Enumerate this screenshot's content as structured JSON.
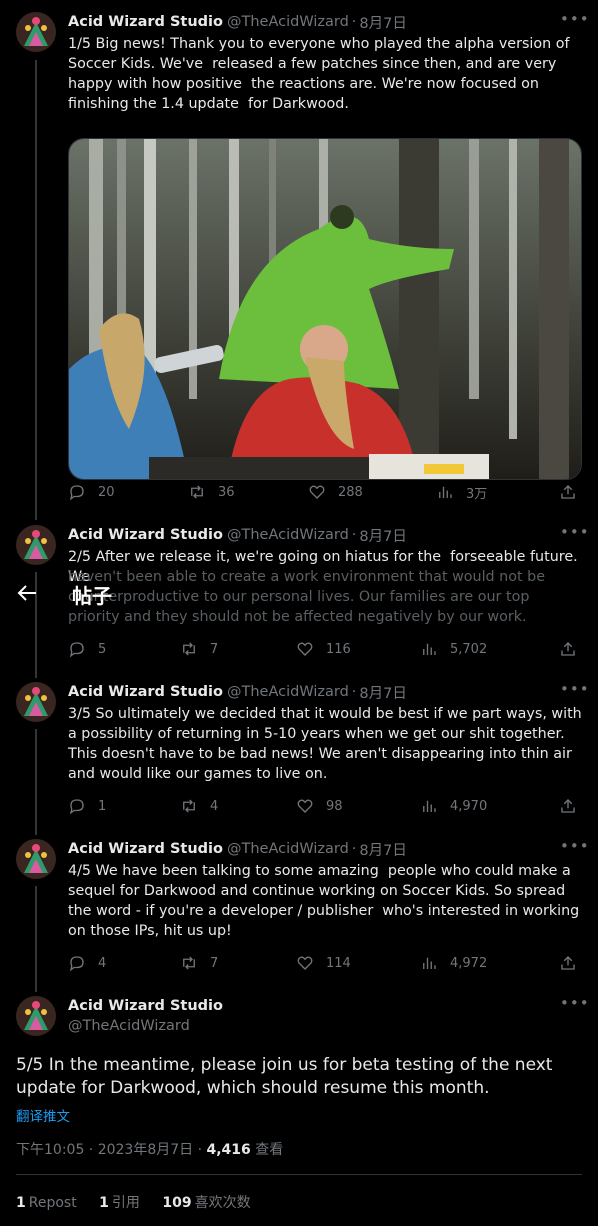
{
  "page": {
    "title": "帖子"
  },
  "account": {
    "name": "Acid Wizard Studio",
    "handle": "@TheAcidWizard",
    "separator": "·"
  },
  "tweets": [
    {
      "date": "8月7日",
      "text": "1/5 Big news! Thank you to everyone who played the alpha version of Soccer Kids. We've  released a few patches since then, and are very happy with how positive  the reactions are. We're now focused on finishing the 1.4 update  for Darkwood.",
      "replies": "20",
      "retweets": "36",
      "likes": "288",
      "views": "3万"
    },
    {
      "date": "8月7日",
      "text_line1": "2/5 After we release it, we're going on hiatus for the  forseeable future. We",
      "text_faded": "haven't been able to create a work environment that would not be counterproductive to our personal lives. Our families are our top priority and they should not be affected negatively by our work.",
      "replies": "5",
      "retweets": "7",
      "likes": "116",
      "views": "5,702"
    },
    {
      "date": "8月7日",
      "text": "3/5 So ultimately we decided that it would be best if we part ways, with a possibility of returning in 5-10 years when we get our shit together. This doesn't have to be bad news! We aren't disappearing into thin air and would like our games to live on.",
      "replies": "1",
      "retweets": "4",
      "likes": "98",
      "views": "4,970"
    },
    {
      "date": "8月7日",
      "text": "4/5 We have been talking to some amazing  people who could make a sequel for Darkwood and continue working on Soccer Kids. So spread the word - if you're a developer / publisher  who's interested in working on those IPs, hit us up!",
      "replies": "4",
      "retweets": "7",
      "likes": "114",
      "views": "4,972"
    }
  ],
  "main_tweet": {
    "text": "5/5 In the meantime, please join us for beta testing of the next update for Darkwood, which should resume this month.",
    "translate": "翻译推文",
    "timestamp": "下午10:05 · 2023年8月7日 · ",
    "views_count": "4,416",
    "views_label": "查看",
    "reposts_count": "1",
    "reposts_label": "Repost",
    "quotes_count": "1",
    "quotes_label": "引用",
    "likes_count": "109",
    "likes_label": "喜欢次数"
  },
  "colors": {
    "background": "#000000",
    "text": "#e7e9ea",
    "muted": "#71767b",
    "link": "#1d9bf0"
  }
}
